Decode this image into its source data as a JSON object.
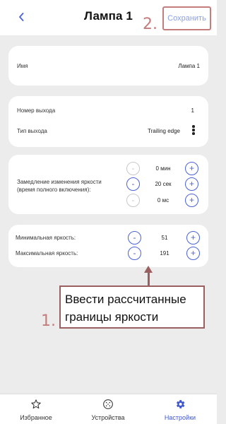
{
  "header": {
    "title": "Лампа 1",
    "save_label": "Сохранить",
    "step_label": "2."
  },
  "card_name": {
    "label": "Имя",
    "value": "Лампа 1"
  },
  "card_output": {
    "number_label": "Номер выхода",
    "number_value": "1",
    "type_label": "Тип выхода",
    "type_value": "Trailing edge"
  },
  "card_dimming": {
    "label": "Замедление изменения яркости (время полного включения):",
    "rows": [
      {
        "value": "0 мин",
        "minus_enabled": false
      },
      {
        "value": "20 сек",
        "minus_enabled": true
      },
      {
        "value": "0 мс",
        "minus_enabled": false
      }
    ],
    "minus_symbol": "-",
    "plus_symbol": "+"
  },
  "card_brightness": {
    "min_label": "Минимальная яркость:",
    "min_value": "51",
    "max_label": "Максимальная яркость:",
    "max_value": "191",
    "minus_symbol": "-",
    "plus_symbol": "+"
  },
  "annotation": {
    "text": "Ввести рассчитанные границы яркости",
    "step_label": "1.",
    "color": "#9a6060"
  },
  "bottom_nav": {
    "items": [
      {
        "label": "Избранное",
        "icon": "star-icon",
        "active": false
      },
      {
        "label": "Устройства",
        "icon": "devices-icon",
        "active": false
      },
      {
        "label": "Настройки",
        "icon": "settings-icon",
        "active": true
      }
    ]
  },
  "colors": {
    "accent": "#4a62d8",
    "annotation": "#c47d7d",
    "background": "#ececec"
  }
}
